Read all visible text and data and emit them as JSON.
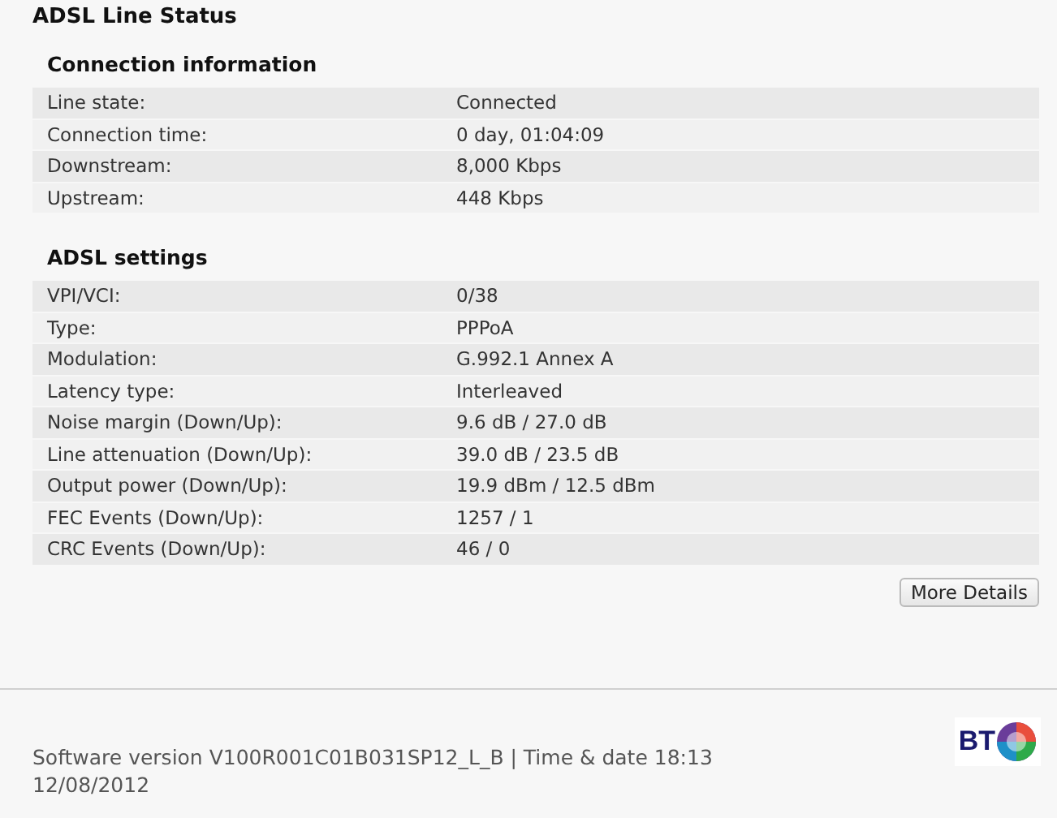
{
  "title": "ADSL Line Status",
  "sections": [
    {
      "heading": "Connection information",
      "rows": [
        {
          "label": "Line state:",
          "value": "Connected"
        },
        {
          "label": "Connection time:",
          "value": "0 day, 01:04:09"
        },
        {
          "label": "Downstream:",
          "value": "8,000 Kbps"
        },
        {
          "label": "Upstream:",
          "value": "448 Kbps"
        }
      ]
    },
    {
      "heading": "ADSL settings",
      "rows": [
        {
          "label": "VPI/VCI:",
          "value": "0/38"
        },
        {
          "label": "Type:",
          "value": "PPPoA"
        },
        {
          "label": "Modulation:",
          "value": "G.992.1 Annex A"
        },
        {
          "label": "Latency type:",
          "value": "Interleaved"
        },
        {
          "label": "Noise margin (Down/Up):",
          "value": "9.6 dB / 27.0 dB"
        },
        {
          "label": "Line attenuation (Down/Up):",
          "value": "39.0 dB / 23.5 dB"
        },
        {
          "label": "Output power (Down/Up):",
          "value": "19.9 dBm / 12.5 dBm"
        },
        {
          "label": "FEC Events (Down/Up):",
          "value": "1257 / 1"
        },
        {
          "label": "CRC Events (Down/Up):",
          "value": "46 / 0"
        }
      ]
    }
  ],
  "button": "More Details",
  "footer": {
    "text": "Software version V100R001C01B031SP12_L_B | Time & date 18:13 12/08/2012",
    "logo": "BT"
  }
}
